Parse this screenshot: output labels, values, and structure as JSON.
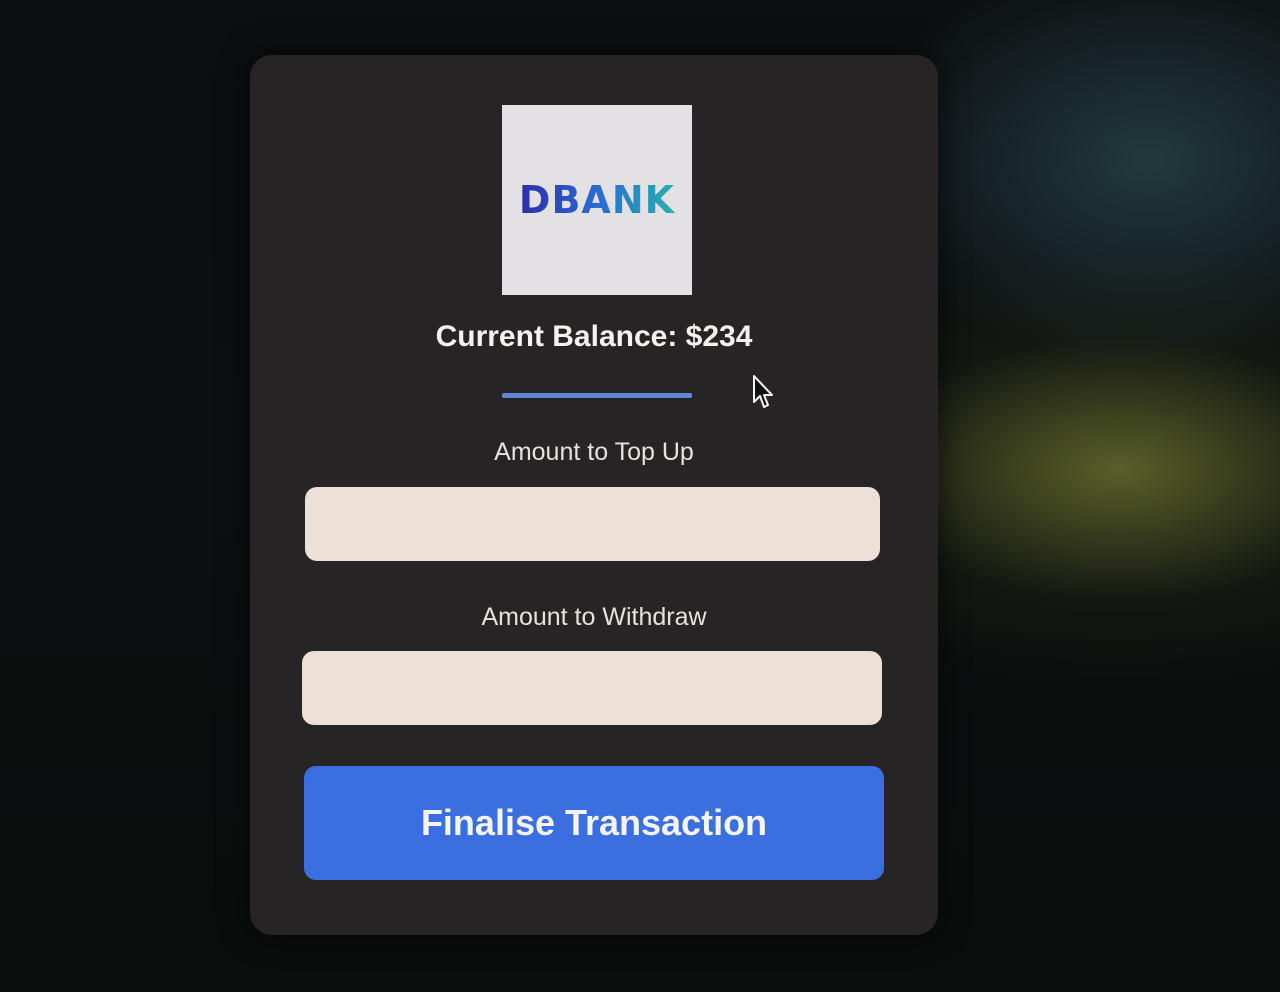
{
  "logo": {
    "text": "DBANK"
  },
  "balance": {
    "text": "Current Balance: $234"
  },
  "topup": {
    "label": "Amount to Top Up",
    "value": ""
  },
  "withdraw": {
    "label": "Amount to Withdraw",
    "value": ""
  },
  "finalise_button": {
    "label": "Finalise Transaction"
  },
  "colors": {
    "accent": "#3b6fe0",
    "card_background": "#272425",
    "input_background": "#ede0d6"
  },
  "icons": {
    "cursor": "mouse-pointer-icon"
  }
}
